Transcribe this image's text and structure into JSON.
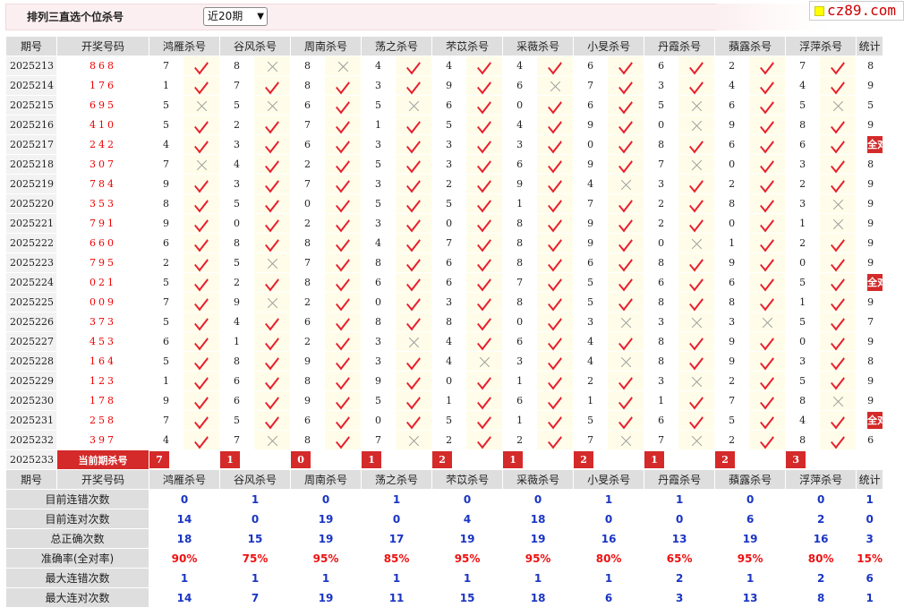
{
  "page": {
    "title": "排列三直选个位杀号",
    "period_selected": "近20期",
    "logo_text": "cz89.com"
  },
  "headers": {
    "issue": "期号",
    "winning": "开奖号码",
    "stat": "统计",
    "experts": [
      "鸿雁杀号",
      "谷风杀号",
      "周南杀号",
      "荡之杀号",
      "芣苡杀号",
      "采薇杀号",
      "小旻杀号",
      "丹霞杀号",
      "蘋露杀号",
      "浮萍杀号"
    ]
  },
  "rows": [
    {
      "issue": "2025213",
      "win": "868",
      "kills": [
        "7",
        "8",
        "8",
        "4",
        "4",
        "4",
        "6",
        "6",
        "2",
        "7"
      ],
      "marks": [
        1,
        0,
        0,
        1,
        1,
        1,
        1,
        1,
        1,
        1
      ],
      "stat": "8"
    },
    {
      "issue": "2025214",
      "win": "176",
      "kills": [
        "1",
        "7",
        "8",
        "3",
        "9",
        "6",
        "7",
        "3",
        "4",
        "4"
      ],
      "marks": [
        1,
        1,
        1,
        1,
        1,
        0,
        1,
        1,
        1,
        1
      ],
      "stat": "9"
    },
    {
      "issue": "2025215",
      "win": "695",
      "kills": [
        "5",
        "5",
        "6",
        "5",
        "6",
        "0",
        "6",
        "5",
        "6",
        "5"
      ],
      "marks": [
        0,
        0,
        1,
        0,
        1,
        1,
        1,
        0,
        1,
        0
      ],
      "stat": "5"
    },
    {
      "issue": "2025216",
      "win": "410",
      "kills": [
        "5",
        "2",
        "7",
        "1",
        "5",
        "4",
        "9",
        "0",
        "9",
        "8"
      ],
      "marks": [
        1,
        1,
        1,
        1,
        1,
        1,
        1,
        0,
        1,
        1
      ],
      "stat": "9"
    },
    {
      "issue": "2025217",
      "win": "242",
      "kills": [
        "4",
        "3",
        "6",
        "3",
        "3",
        "3",
        "0",
        "8",
        "6",
        "6"
      ],
      "marks": [
        1,
        1,
        1,
        1,
        1,
        1,
        1,
        1,
        1,
        1
      ],
      "stat": "全对"
    },
    {
      "issue": "2025218",
      "win": "307",
      "kills": [
        "7",
        "4",
        "2",
        "5",
        "3",
        "6",
        "9",
        "7",
        "0",
        "3"
      ],
      "marks": [
        0,
        1,
        1,
        1,
        1,
        1,
        1,
        0,
        1,
        1
      ],
      "stat": "8"
    },
    {
      "issue": "2025219",
      "win": "784",
      "kills": [
        "9",
        "3",
        "7",
        "3",
        "2",
        "9",
        "4",
        "3",
        "2",
        "2"
      ],
      "marks": [
        1,
        1,
        1,
        1,
        1,
        1,
        0,
        1,
        1,
        1
      ],
      "stat": "9"
    },
    {
      "issue": "2025220",
      "win": "353",
      "kills": [
        "8",
        "5",
        "0",
        "5",
        "5",
        "1",
        "7",
        "2",
        "8",
        "3"
      ],
      "marks": [
        1,
        1,
        1,
        1,
        1,
        1,
        1,
        1,
        1,
        0
      ],
      "stat": "9"
    },
    {
      "issue": "2025221",
      "win": "791",
      "kills": [
        "9",
        "0",
        "2",
        "3",
        "0",
        "8",
        "9",
        "2",
        "0",
        "1"
      ],
      "marks": [
        1,
        1,
        1,
        1,
        1,
        1,
        1,
        1,
        1,
        0
      ],
      "stat": "9"
    },
    {
      "issue": "2025222",
      "win": "660",
      "kills": [
        "6",
        "8",
        "8",
        "4",
        "7",
        "8",
        "9",
        "0",
        "1",
        "2"
      ],
      "marks": [
        1,
        1,
        1,
        1,
        1,
        1,
        1,
        0,
        1,
        1
      ],
      "stat": "9"
    },
    {
      "issue": "2025223",
      "win": "795",
      "kills": [
        "2",
        "5",
        "7",
        "8",
        "6",
        "8",
        "6",
        "8",
        "9",
        "0"
      ],
      "marks": [
        1,
        0,
        1,
        1,
        1,
        1,
        1,
        1,
        1,
        1
      ],
      "stat": "9"
    },
    {
      "issue": "2025224",
      "win": "021",
      "kills": [
        "5",
        "2",
        "8",
        "6",
        "6",
        "7",
        "5",
        "6",
        "6",
        "5"
      ],
      "marks": [
        1,
        1,
        1,
        1,
        1,
        1,
        1,
        1,
        1,
        1
      ],
      "stat": "全对"
    },
    {
      "issue": "2025225",
      "win": "009",
      "kills": [
        "7",
        "9",
        "2",
        "0",
        "3",
        "8",
        "5",
        "8",
        "8",
        "1"
      ],
      "marks": [
        1,
        0,
        1,
        1,
        1,
        1,
        1,
        1,
        1,
        1
      ],
      "stat": "9"
    },
    {
      "issue": "2025226",
      "win": "373",
      "kills": [
        "5",
        "4",
        "6",
        "8",
        "8",
        "0",
        "3",
        "3",
        "3",
        "5"
      ],
      "marks": [
        1,
        1,
        1,
        1,
        1,
        1,
        0,
        0,
        0,
        1
      ],
      "stat": "7"
    },
    {
      "issue": "2025227",
      "win": "453",
      "kills": [
        "6",
        "1",
        "2",
        "3",
        "4",
        "6",
        "4",
        "8",
        "9",
        "0"
      ],
      "marks": [
        1,
        1,
        1,
        0,
        1,
        1,
        1,
        1,
        1,
        1
      ],
      "stat": "9"
    },
    {
      "issue": "2025228",
      "win": "164",
      "kills": [
        "5",
        "8",
        "9",
        "3",
        "4",
        "3",
        "4",
        "8",
        "9",
        "3"
      ],
      "marks": [
        1,
        1,
        1,
        1,
        0,
        1,
        0,
        1,
        1,
        1
      ],
      "stat": "8"
    },
    {
      "issue": "2025229",
      "win": "123",
      "kills": [
        "1",
        "6",
        "8",
        "9",
        "0",
        "1",
        "2",
        "3",
        "2",
        "5"
      ],
      "marks": [
        1,
        1,
        1,
        1,
        1,
        1,
        1,
        0,
        1,
        1
      ],
      "stat": "9"
    },
    {
      "issue": "2025230",
      "win": "178",
      "kills": [
        "9",
        "6",
        "9",
        "5",
        "1",
        "6",
        "1",
        "1",
        "7",
        "8"
      ],
      "marks": [
        1,
        1,
        1,
        1,
        1,
        1,
        1,
        1,
        1,
        0
      ],
      "stat": "9"
    },
    {
      "issue": "2025231",
      "win": "258",
      "kills": [
        "7",
        "5",
        "6",
        "0",
        "5",
        "1",
        "5",
        "6",
        "5",
        "4"
      ],
      "marks": [
        1,
        1,
        1,
        1,
        1,
        1,
        1,
        1,
        1,
        1
      ],
      "stat": "全对"
    },
    {
      "issue": "2025232",
      "win": "397",
      "kills": [
        "4",
        "7",
        "8",
        "7",
        "2",
        "2",
        "7",
        "7",
        "2",
        "8"
      ],
      "marks": [
        1,
        0,
        1,
        0,
        1,
        1,
        0,
        0,
        1,
        1
      ],
      "stat": "6"
    }
  ],
  "current": {
    "issue": "2025233",
    "label": "当前期杀号",
    "kills": [
      "7",
      "1",
      "0",
      "1",
      "2",
      "1",
      "2",
      "1",
      "2",
      "3"
    ],
    "stat": ""
  },
  "stats": [
    {
      "label": "目前连错次数",
      "values": [
        "0",
        "1",
        "0",
        "1",
        "0",
        "0",
        "1",
        "1",
        "0",
        "0"
      ],
      "stat": "1"
    },
    {
      "label": "目前连对次数",
      "values": [
        "14",
        "0",
        "19",
        "0",
        "4",
        "18",
        "0",
        "0",
        "6",
        "2"
      ],
      "stat": "0"
    },
    {
      "label": "总正确次数",
      "values": [
        "18",
        "15",
        "19",
        "17",
        "19",
        "19",
        "16",
        "13",
        "19",
        "16"
      ],
      "stat": "3"
    },
    {
      "label": "准确率(全对率)",
      "values": [
        "90%",
        "75%",
        "95%",
        "85%",
        "95%",
        "95%",
        "80%",
        "65%",
        "95%",
        "80%"
      ],
      "stat": "15%"
    },
    {
      "label": "最大连错次数",
      "values": [
        "1",
        "1",
        "1",
        "1",
        "1",
        "1",
        "1",
        "2",
        "1",
        "2"
      ],
      "stat": "6"
    },
    {
      "label": "最大连对次数",
      "values": [
        "14",
        "7",
        "19",
        "11",
        "15",
        "18",
        "6",
        "3",
        "13",
        "8"
      ],
      "stat": "1"
    }
  ],
  "colors": {
    "accent": "#d42a2a",
    "check": "#e8202e",
    "stat_blue": "#1a35c4",
    "header_bg": "#dedede",
    "mark_bg": "#fffde9"
  },
  "icons": {
    "correct": "checkmark-icon",
    "wrong": "cross-icon"
  }
}
